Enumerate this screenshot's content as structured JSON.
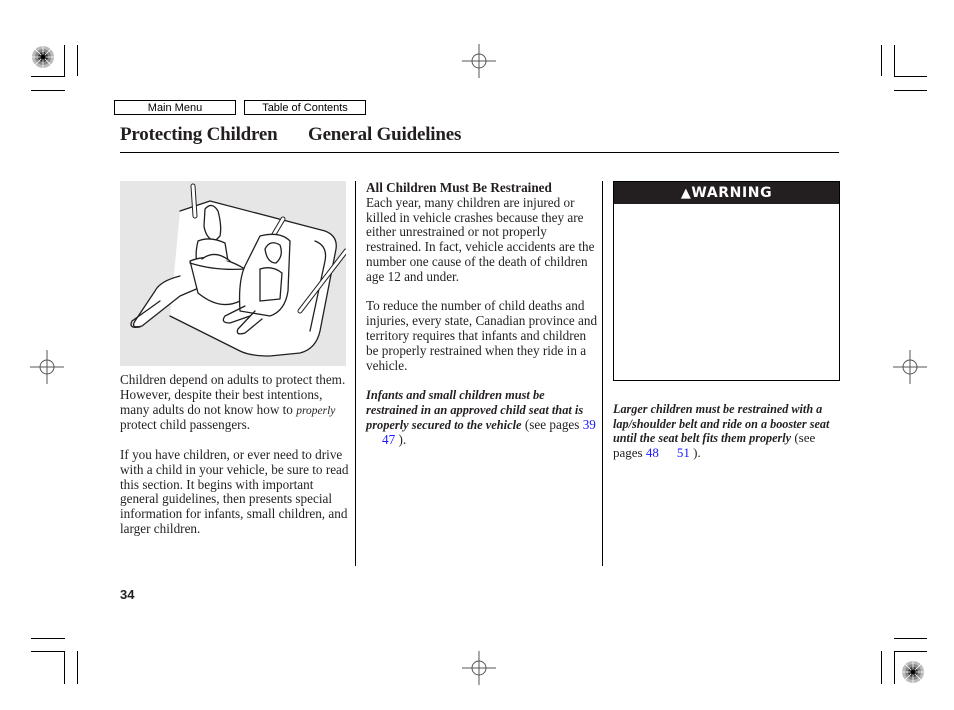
{
  "nav": {
    "main_menu": "Main Menu",
    "table_of_contents": "Table of Contents"
  },
  "header": {
    "section": "Protecting Children",
    "subsection": "General Guidelines"
  },
  "figure": {
    "icon": "child-seat-illustration",
    "description": "Adult with infant seat and child in child seat on vehicle rear seat"
  },
  "column1": {
    "para1_before": "Children depend on adults to protect them. However, despite their best intentions, many adults do not know how to ",
    "para1_italic": "properly",
    "para1_after": " protect child passengers.",
    "para2": "If you have children, or ever need to drive with a child in your vehicle, be sure to read this section. It begins with important general guidelines, then presents special information for infants, small children, and larger children."
  },
  "column2": {
    "heading": "All Children Must Be Restrained",
    "para1": "Each year, many children are injured or killed in vehicle crashes because they are either unrestrained or not properly restrained. In fact, vehicle accidents are the number one cause of the death of children age 12 and under.",
    "para2": "To reduce the number of child deaths and injuries, every state, Canadian province and territory requires that infants and children be properly restrained when they ride in a vehicle.",
    "note_bold": "Infants and small children must be restrained in an approved child seat that is properly secured to the vehicle",
    "note_see": " (see pages ",
    "link1": "39",
    "link2": "47",
    "note_end": " )."
  },
  "column3": {
    "warning_label": "WARNING",
    "warning_icon": "warning-triangle",
    "note_bold": "Larger children must be restrained with a lap/shoulder belt and ride on a booster seat until the seat belt fits them properly",
    "note_see": " (see pages ",
    "link1": "48",
    "link2": "51",
    "note_end": " )."
  },
  "footer": {
    "page_number": "34"
  }
}
